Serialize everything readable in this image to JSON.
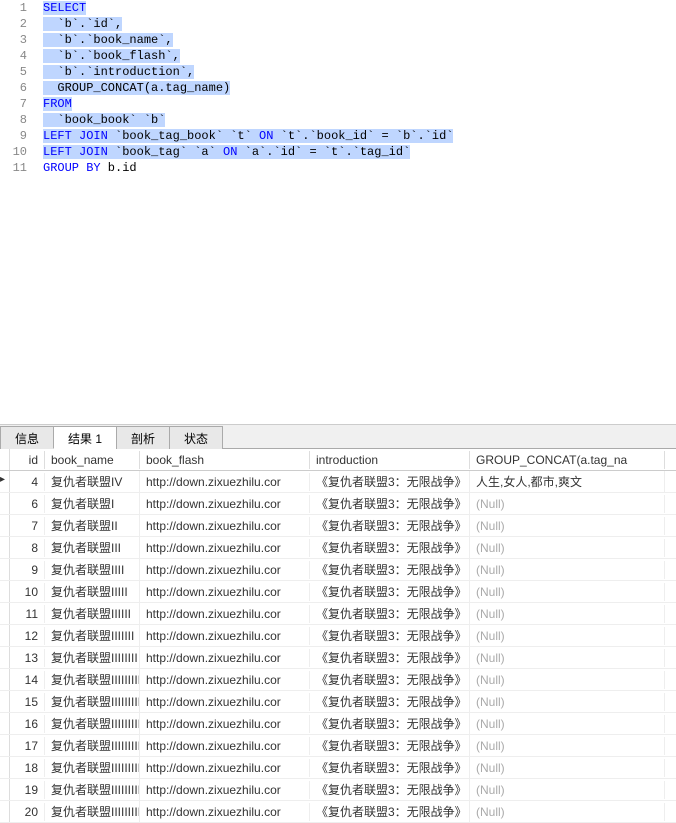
{
  "editor": {
    "lines": [
      {
        "n": 1,
        "tokens": [
          [
            "sel kw",
            "SELECT"
          ]
        ]
      },
      {
        "n": 2,
        "tokens": [
          [
            "sel",
            "  `b`.`id`,"
          ]
        ]
      },
      {
        "n": 3,
        "tokens": [
          [
            "sel",
            "  `b`.`book_name`,"
          ]
        ]
      },
      {
        "n": 4,
        "tokens": [
          [
            "sel",
            "  `b`.`book_flash`,"
          ]
        ]
      },
      {
        "n": 5,
        "tokens": [
          [
            "sel",
            "  `b`.`introduction`,"
          ]
        ]
      },
      {
        "n": 6,
        "tokens": [
          [
            "sel",
            "  GROUP_CONCAT(a.tag_name)"
          ]
        ]
      },
      {
        "n": 7,
        "tokens": [
          [
            "sel kw",
            "FROM"
          ]
        ]
      },
      {
        "n": 8,
        "tokens": [
          [
            "sel",
            "  `book_book` `b`"
          ]
        ]
      },
      {
        "n": 9,
        "tokens": [
          [
            "sel kw",
            "LEFT JOIN"
          ],
          [
            "sel",
            " `book_tag_book` `t` "
          ],
          [
            "sel kw",
            "ON"
          ],
          [
            "sel",
            " `t`.`book_id` = `b`.`id`"
          ]
        ]
      },
      {
        "n": 10,
        "tokens": [
          [
            "sel kw",
            "LEFT JOIN"
          ],
          [
            "sel",
            " `book_tag` `a` "
          ],
          [
            "sel kw",
            "ON"
          ],
          [
            "sel",
            " `a`.`id` = `t`.`tag_id`"
          ]
        ]
      },
      {
        "n": 11,
        "tokens": [
          [
            "kw",
            "GROUP BY"
          ],
          [
            "",
            " b.id"
          ]
        ]
      }
    ]
  },
  "tabs": [
    {
      "label": "信息",
      "active": false
    },
    {
      "label": "结果 1",
      "active": true
    },
    {
      "label": "剖析",
      "active": false
    },
    {
      "label": "状态",
      "active": false
    }
  ],
  "columns": [
    "id",
    "book_name",
    "book_flash",
    "introduction",
    "GROUP_CONCAT(a.tag_na"
  ],
  "chart_data": {
    "type": "table",
    "columns": [
      "id",
      "book_name",
      "book_flash",
      "introduction",
      "GROUP_CONCAT(a.tag_name)"
    ],
    "rows": [
      {
        "id": 4,
        "book_name": "复仇者联盟IV",
        "book_flash": "http://down.zixuezhilu.cor",
        "introduction": "《复仇者联盟3：无限战争》",
        "gc": "人生,女人,都市,爽文"
      },
      {
        "id": 6,
        "book_name": "复仇者联盟I",
        "book_flash": "http://down.zixuezhilu.cor",
        "introduction": "《复仇者联盟3：无限战争》",
        "gc": null
      },
      {
        "id": 7,
        "book_name": "复仇者联盟II",
        "book_flash": "http://down.zixuezhilu.cor",
        "introduction": "《复仇者联盟3：无限战争》",
        "gc": null
      },
      {
        "id": 8,
        "book_name": "复仇者联盟III",
        "book_flash": "http://down.zixuezhilu.cor",
        "introduction": "《复仇者联盟3：无限战争》",
        "gc": null
      },
      {
        "id": 9,
        "book_name": "复仇者联盟IIII",
        "book_flash": "http://down.zixuezhilu.cor",
        "introduction": "《复仇者联盟3：无限战争》",
        "gc": null
      },
      {
        "id": 10,
        "book_name": "复仇者联盟IIIII",
        "book_flash": "http://down.zixuezhilu.cor",
        "introduction": "《复仇者联盟3：无限战争》",
        "gc": null
      },
      {
        "id": 11,
        "book_name": "复仇者联盟IIIIII",
        "book_flash": "http://down.zixuezhilu.cor",
        "introduction": "《复仇者联盟3：无限战争》",
        "gc": null
      },
      {
        "id": 12,
        "book_name": "复仇者联盟IIIIIII",
        "book_flash": "http://down.zixuezhilu.cor",
        "introduction": "《复仇者联盟3：无限战争》",
        "gc": null
      },
      {
        "id": 13,
        "book_name": "复仇者联盟IIIIIIII",
        "book_flash": "http://down.zixuezhilu.cor",
        "introduction": "《复仇者联盟3：无限战争》",
        "gc": null
      },
      {
        "id": 14,
        "book_name": "复仇者联盟IIIIIIIII",
        "book_flash": "http://down.zixuezhilu.cor",
        "introduction": "《复仇者联盟3：无限战争》",
        "gc": null
      },
      {
        "id": 15,
        "book_name": "复仇者联盟IIIIIIIIII",
        "book_flash": "http://down.zixuezhilu.cor",
        "introduction": "《复仇者联盟3：无限战争》",
        "gc": null
      },
      {
        "id": 16,
        "book_name": "复仇者联盟IIIIIIIIIII",
        "book_flash": "http://down.zixuezhilu.cor",
        "introduction": "《复仇者联盟3：无限战争》",
        "gc": null
      },
      {
        "id": 17,
        "book_name": "复仇者联盟IIIIIIIIIII",
        "book_flash": "http://down.zixuezhilu.cor",
        "introduction": "《复仇者联盟3：无限战争》",
        "gc": null
      },
      {
        "id": 18,
        "book_name": "复仇者联盟IIIIIIIIIII",
        "book_flash": "http://down.zixuezhilu.cor",
        "introduction": "《复仇者联盟3：无限战争》",
        "gc": null
      },
      {
        "id": 19,
        "book_name": "复仇者联盟IIIIIIIIIII",
        "book_flash": "http://down.zixuezhilu.cor",
        "introduction": "《复仇者联盟3：无限战争》",
        "gc": null
      },
      {
        "id": 20,
        "book_name": "复仇者联盟IIIIIIIIIII",
        "book_flash": "http://down.zixuezhilu.cor",
        "introduction": "《复仇者联盟3：无限战争》",
        "gc": null
      }
    ]
  },
  "null_label": "(Null)"
}
